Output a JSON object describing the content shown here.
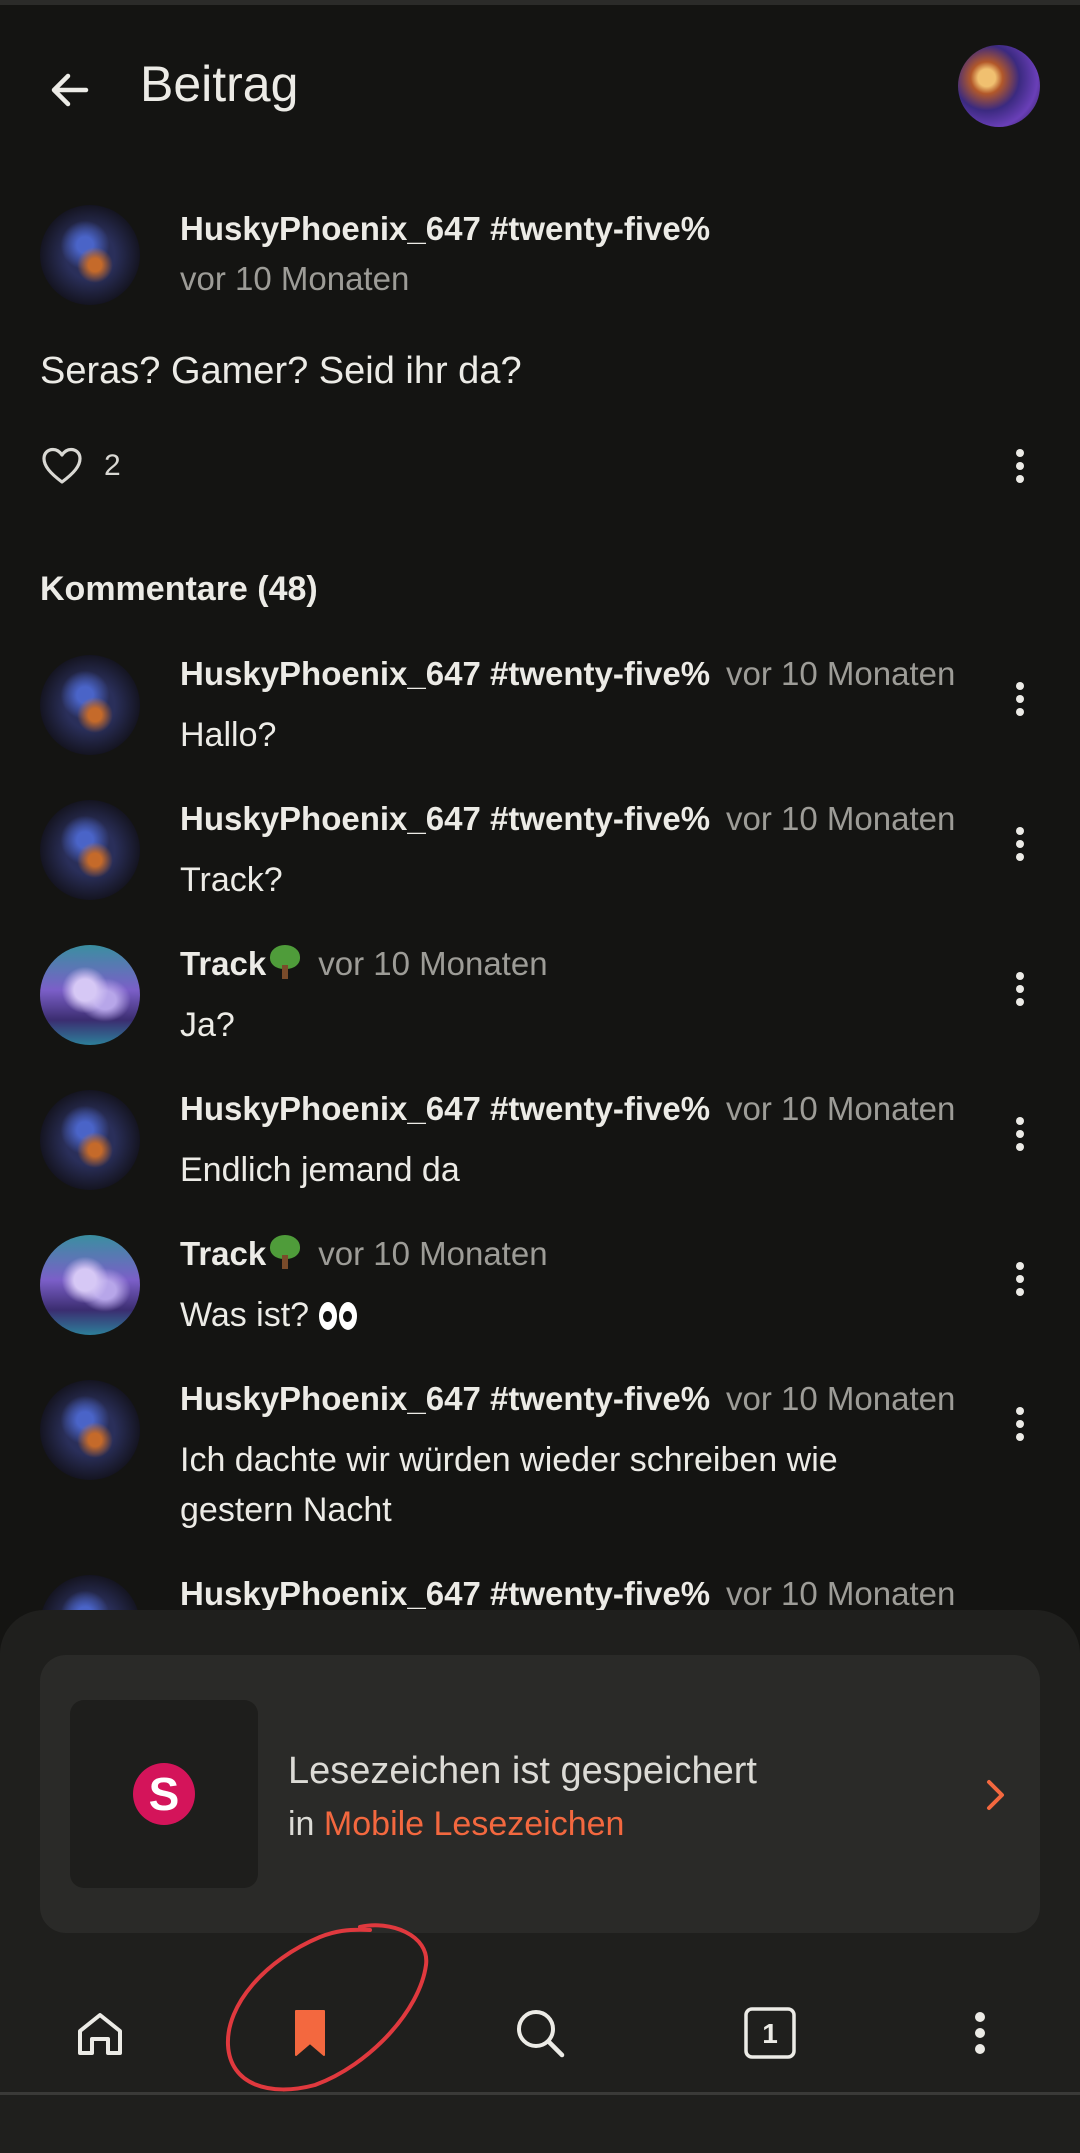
{
  "header": {
    "title": "Beitrag",
    "back_icon": "arrow-left-icon"
  },
  "post": {
    "author": "HuskyPhoenix_647 #twenty-five%",
    "time": "vor 10 Monaten",
    "body": "Seras? Gamer? Seid ihr da?",
    "likes": "2"
  },
  "comments_heading": "Kommentare (48)",
  "comments": [
    {
      "author": "HuskyPhoenix_647 #twenty-five%",
      "time": "vor 10 Monaten",
      "text": "Hallo?"
    },
    {
      "author": "HuskyPhoenix_647 #twenty-five%",
      "time": "vor 10 Monaten",
      "text": "Track?"
    },
    {
      "author": "Track",
      "time": "vor 10 Monaten",
      "text": "Ja?"
    },
    {
      "author": "HuskyPhoenix_647 #twenty-five%",
      "time": "vor 10 Monaten",
      "text": "Endlich jemand da"
    },
    {
      "author": "Track",
      "time": "vor 10 Monaten",
      "text": "Was ist?"
    },
    {
      "author": "HuskyPhoenix_647 #twenty-five%",
      "time": "vor 10 Monaten",
      "text": "Ich dachte wir würden wieder schreiben wie gestern Nacht"
    },
    {
      "author": "HuskyPhoenix_647 #twenty-five%",
      "time": "vor 10 Monaten",
      "text": ""
    }
  ],
  "toast": {
    "logo_letter": "S",
    "title": "Lesezeichen ist gespeichert",
    "sub_prefix": "in",
    "sub_link": "Mobile Lesezeichen"
  },
  "nav": {
    "tab_count": "1"
  },
  "colors": {
    "background": "#141412",
    "accent": "#f3683f",
    "muted": "#9d9c97",
    "sheet": "#1f1f1d",
    "logo": "#d4145a",
    "annotation": "#e0393e"
  }
}
